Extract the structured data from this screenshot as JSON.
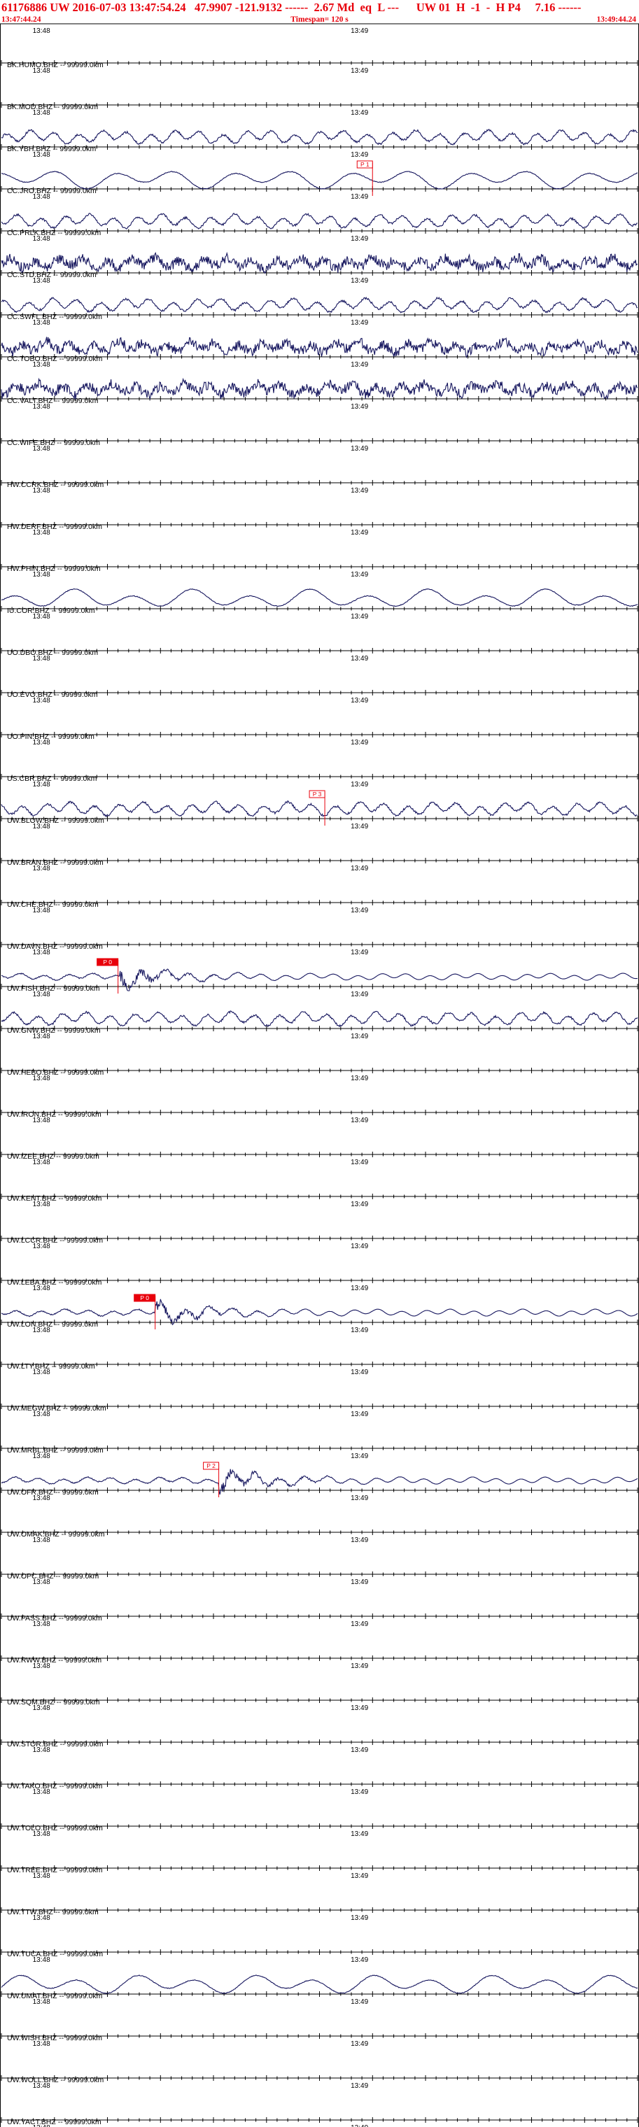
{
  "header": {
    "line1": "61176886 UW 2016-07-03 13:47:54.24   47.9907 -121.9132 ------  2.67 Md  eq  L ---      UW 01  H  -1  -  H P4     7.16 ------",
    "start_time": "13:47:44.24",
    "timespan": "Timespan= 120 s",
    "end_time": "13:49:44.24"
  },
  "colors": {
    "header_text": "#e8000b",
    "trace": "#16165e",
    "axis": "#000000",
    "pick": "#e8000b",
    "background": "#ffffff"
  },
  "chart_data": {
    "type": "line",
    "title": "61176886 UW 2016-07-03 13:47:54.24",
    "x_unit": "s",
    "x_range_s": [
      0,
      120
    ],
    "axis_tick_labels": [
      "13:48",
      "13:49"
    ],
    "traces": [
      {
        "label": "BK.HUMO.BHZ -- 99999.0km",
        "signal": "none"
      },
      {
        "label": "BK.MOD.BHZ -- 99999.0km",
        "signal": "none"
      },
      {
        "label": "BK.YBH.BHZ -- 99999.0km",
        "signal": "microseism"
      },
      {
        "label": "CC.JRO.BHZ -- 99999.0km",
        "signal": "longperiod",
        "pick": {
          "label": "P 1",
          "t": 70
        }
      },
      {
        "label": "CC.PRLK.BHZ -- 99999.0km",
        "signal": "microseism"
      },
      {
        "label": "CC.STD.BHZ -- 99999.0km",
        "signal": "noisy"
      },
      {
        "label": "CC.SWFL.BHZ -- 99999.0km",
        "signal": "microseism"
      },
      {
        "label": "CC.TOBO.BHZ -- 99999.0km",
        "signal": "noisy"
      },
      {
        "label": "CC.VALT.BHZ -- 99999.0km",
        "signal": "noisy"
      },
      {
        "label": "CC.WIFE.BHZ -- 99999.0km",
        "signal": "none"
      },
      {
        "label": "HW.CCRK.BHZ -- 99999.0km",
        "signal": "none"
      },
      {
        "label": "HW.DERF.BHZ -- 99999.0km",
        "signal": "none"
      },
      {
        "label": "HW.PHIN.BHZ -- 99999.0km",
        "signal": "none"
      },
      {
        "label": "IU.COR.BHZ -- 99999.0km",
        "signal": "longperiod"
      },
      {
        "label": "UO.DBO.BHZ -- 99999.0km",
        "signal": "none"
      },
      {
        "label": "UO.EVO.BHZ -- 99999.0km",
        "signal": "none"
      },
      {
        "label": "UO.PIN.BHZ -- 99999.0km",
        "signal": "none"
      },
      {
        "label": "US.CBR.BHZ -- 99999.0km",
        "signal": "none"
      },
      {
        "label": "UW.BLOW.BHZ -- 99999.0km",
        "signal": "microseism",
        "pick": {
          "label": "P 3",
          "t": 61
        }
      },
      {
        "label": "UW.BRAN.BHZ -- 99999.0km",
        "signal": "none"
      },
      {
        "label": "UW.CHE.BHZ -- 99999.0km",
        "signal": "none"
      },
      {
        "label": "UW.DAVN.BHZ -- 99999.0km",
        "signal": "none"
      },
      {
        "label": "UW.FISH.BHZ -- 99999.0km",
        "signal": "event",
        "pick": {
          "label": "P 0",
          "t": 22,
          "filled": true
        }
      },
      {
        "label": "UW.GNW.BHZ -- 99999.0km",
        "signal": "microseism"
      },
      {
        "label": "UW.HEBO.BHZ -- 99999.0km",
        "signal": "none"
      },
      {
        "label": "UW.IRON.BHZ -- 99999.0km",
        "signal": "none"
      },
      {
        "label": "UW.IZEE.BHZ -- 99999.0km",
        "signal": "none"
      },
      {
        "label": "UW.KENT.BHZ -- 99999.0km",
        "signal": "none"
      },
      {
        "label": "UW.LCCR.BHZ -- 99999.0km",
        "signal": "none"
      },
      {
        "label": "UW.LEBA.BHZ -- 99999.0km",
        "signal": "none"
      },
      {
        "label": "UW.LON.BHZ -- 99999.0km",
        "signal": "event",
        "pick": {
          "label": "P 0",
          "t": 29,
          "filled": true
        }
      },
      {
        "label": "UW.LTY.BHZ -- 99999.0km",
        "signal": "none"
      },
      {
        "label": "UW.MEGW.BHZ -- 99999.0km",
        "signal": "none"
      },
      {
        "label": "UW.MRBL.BHZ -- 99999.0km",
        "signal": "none"
      },
      {
        "label": "UW.OFR.BHZ -- 99999.0km",
        "signal": "event",
        "pick": {
          "label": "P 2",
          "t": 41
        }
      },
      {
        "label": "UW.OMAK.BHZ -- 99999.0km",
        "signal": "none"
      },
      {
        "label": "UW.OPC.BHZ -- 99999.0km",
        "signal": "none"
      },
      {
        "label": "UW.PASS.BHZ -- 99999.0km",
        "signal": "none"
      },
      {
        "label": "UW.RWW.BHZ -- 99999.0km",
        "signal": "none"
      },
      {
        "label": "UW.SQM.BHZ -- 99999.0km",
        "signal": "none"
      },
      {
        "label": "UW.STOR.BHZ -- 99999.0km",
        "signal": "none"
      },
      {
        "label": "UW.TAKO.BHZ -- 99999.0km",
        "signal": "none"
      },
      {
        "label": "UW.TOLO.BHZ -- 99999.0km",
        "signal": "none"
      },
      {
        "label": "UW.TREE.BHZ -- 99999.0km",
        "signal": "none"
      },
      {
        "label": "UW.TTW.BHZ -- 99999.0km",
        "signal": "none"
      },
      {
        "label": "UW.TUCA.BHZ -- 99999.0km",
        "signal": "none"
      },
      {
        "label": "UW.UMAT.BHZ -- 99999.0km",
        "signal": "longperiod"
      },
      {
        "label": "UW.WISH.BHZ -- 99999.0km",
        "signal": "none"
      },
      {
        "label": "UW.WOLL.BHZ -- 99999.0km",
        "signal": "none"
      },
      {
        "label": "UW.YACT.BHZ -- 99999.0km",
        "signal": "none"
      }
    ]
  }
}
